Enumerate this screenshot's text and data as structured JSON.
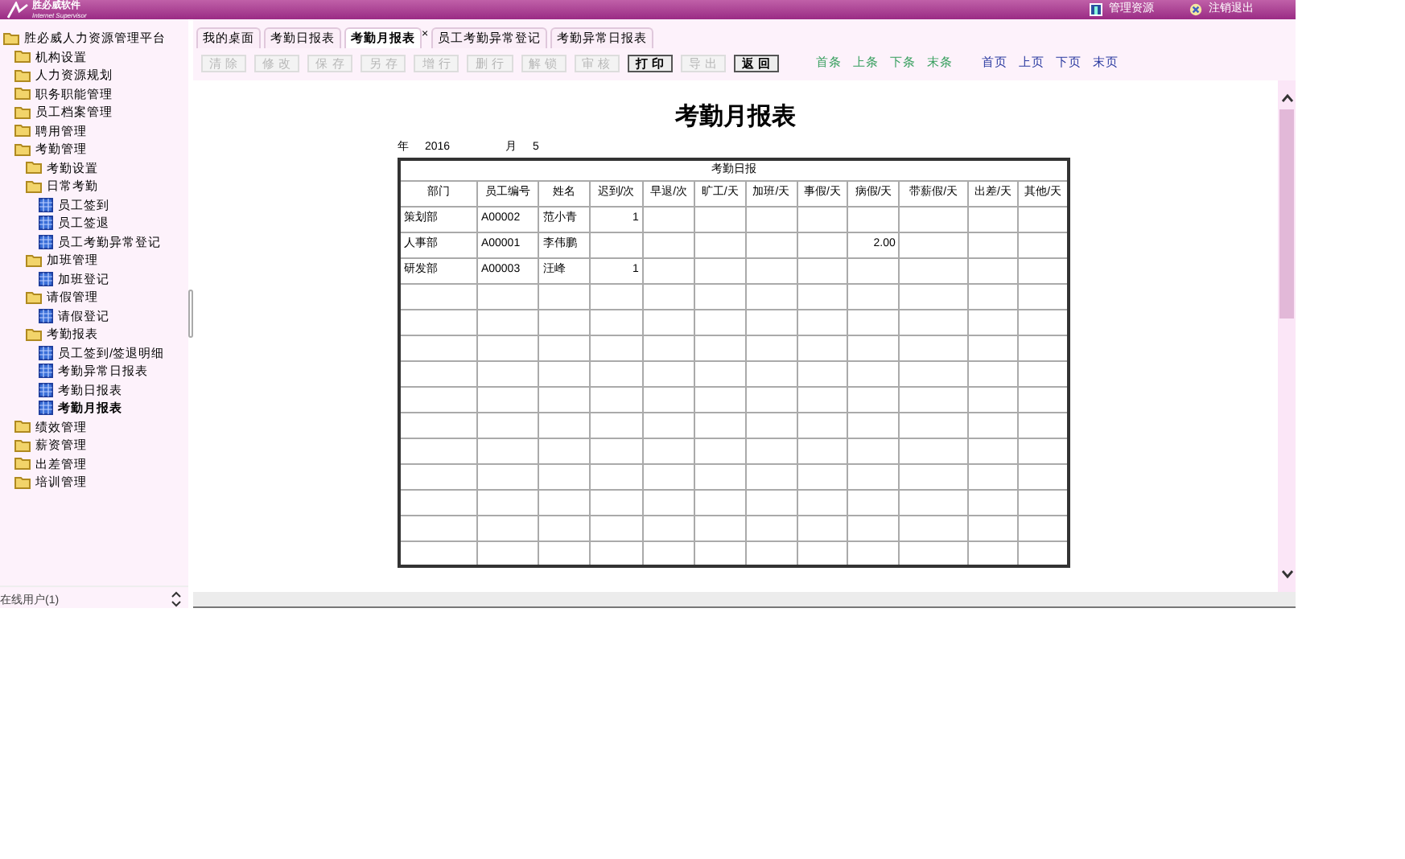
{
  "header": {
    "logo_text": "胜必威软件",
    "logo_subtext": "Internet Supervisor",
    "links": [
      {
        "kind": "resources",
        "label": "管理资源"
      },
      {
        "kind": "logout",
        "label": "注销退出"
      }
    ]
  },
  "sidebar": {
    "tree": [
      {
        "label": "胜必威人力资源管理平台",
        "kind": "folder",
        "selected": false,
        "children": [
          {
            "label": "机构设置",
            "kind": "folder",
            "selected": false
          },
          {
            "label": "人力资源规划",
            "kind": "folder",
            "selected": false
          },
          {
            "label": "职务职能管理",
            "kind": "folder",
            "selected": false
          },
          {
            "label": "员工档案管理",
            "kind": "folder",
            "selected": false
          },
          {
            "label": "聘用管理",
            "kind": "folder",
            "selected": false
          },
          {
            "label": "考勤管理",
            "kind": "folder",
            "selected": false,
            "children": [
              {
                "label": "考勤设置",
                "kind": "folder",
                "selected": false
              },
              {
                "label": "日常考勤",
                "kind": "folder",
                "selected": false,
                "children": [
                  {
                    "label": "员工签到",
                    "kind": "page",
                    "selected": false
                  },
                  {
                    "label": "员工签退",
                    "kind": "page",
                    "selected": false
                  },
                  {
                    "label": "员工考勤异常登记",
                    "kind": "page",
                    "selected": false
                  }
                ]
              },
              {
                "label": "加班管理",
                "kind": "folder",
                "selected": false,
                "children": [
                  {
                    "label": "加班登记",
                    "kind": "page",
                    "selected": false
                  }
                ]
              },
              {
                "label": "请假管理",
                "kind": "folder",
                "selected": false,
                "children": [
                  {
                    "label": "请假登记",
                    "kind": "page",
                    "selected": false
                  }
                ]
              },
              {
                "label": "考勤报表",
                "kind": "folder",
                "selected": false,
                "children": [
                  {
                    "label": "员工签到/签退明细",
                    "kind": "page",
                    "selected": false
                  },
                  {
                    "label": "考勤异常日报表",
                    "kind": "page",
                    "selected": false
                  },
                  {
                    "label": "考勤日报表",
                    "kind": "page",
                    "selected": false
                  },
                  {
                    "label": "考勤月报表",
                    "kind": "page",
                    "selected": true
                  }
                ]
              }
            ]
          },
          {
            "label": "绩效管理",
            "kind": "folder",
            "selected": false
          },
          {
            "label": "薪资管理",
            "kind": "folder",
            "selected": false
          },
          {
            "label": "出差管理",
            "kind": "folder",
            "selected": false
          },
          {
            "label": "培训管理",
            "kind": "folder",
            "selected": false
          }
        ]
      }
    ],
    "footer": "在线用户(1)"
  },
  "tabs": [
    {
      "label": "我的桌面",
      "selected": false
    },
    {
      "label": "考勤日报表",
      "selected": false
    },
    {
      "label": "考勤月报表",
      "selected": true,
      "close": "×"
    },
    {
      "label": "员工考勤异常登记",
      "selected": false
    },
    {
      "label": "考勤异常日报表",
      "selected": false
    }
  ],
  "toolbar": [
    {
      "label": "清 除",
      "disabled": true
    },
    {
      "label": "修 改",
      "disabled": true
    },
    {
      "label": "保 存",
      "disabled": true
    },
    {
      "label": "另 存",
      "disabled": true
    },
    {
      "label": "增 行",
      "disabled": true
    },
    {
      "label": "删 行",
      "disabled": true
    },
    {
      "label": "解 锁",
      "disabled": true
    },
    {
      "label": "审 核",
      "disabled": true
    },
    {
      "label": "打 印",
      "disabled": false
    },
    {
      "label": "导 出",
      "disabled": true
    },
    {
      "label": "返 回",
      "disabled": false
    }
  ],
  "record_nav": [
    "首条",
    "上条",
    "下条",
    "末条"
  ],
  "page_nav": [
    "首页",
    "上页",
    "下页",
    "末页"
  ],
  "report": {
    "title": "考勤月报表",
    "year_label": "年",
    "year": "2016",
    "month_label": "月",
    "month": "5",
    "table_title": "考勤日报",
    "columns": [
      "部门",
      "员工编号",
      "姓名",
      "迟到/次",
      "早退/次",
      "旷工/天",
      "加班/天",
      "事假/天",
      "病假/天",
      "带薪假/天",
      "出差/天",
      "其他/天"
    ],
    "rows": [
      [
        "策划部",
        "A00002",
        "范小青",
        "1",
        "",
        "",
        "",
        "",
        "",
        "",
        "",
        ""
      ],
      [
        "人事部",
        "A00001",
        "李伟鹏",
        "",
        "",
        "",
        "",
        "",
        "2.00",
        "",
        "",
        ""
      ],
      [
        "研发部",
        "A00003",
        "汪峰",
        "1",
        "",
        "",
        "",
        "",
        "",
        "",
        "",
        ""
      ]
    ]
  }
}
